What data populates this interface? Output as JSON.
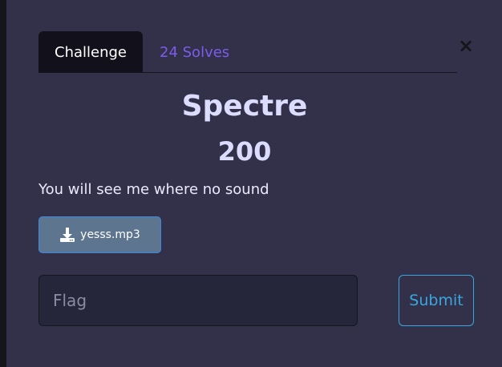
{
  "colors": {
    "background": "#333149",
    "tab_active_bg": "#12111b",
    "tab_inactive_text": "#7c5cec",
    "heading_text": "#dcdcff",
    "file_button_bg": "#5e7590",
    "file_button_border": "#3a86e0",
    "submit_accent": "#3aa6e0"
  },
  "dialog": {
    "close_icon": "close-icon",
    "close_glyph": "×"
  },
  "tabs": [
    {
      "label": "Challenge",
      "active": true
    },
    {
      "label": "24 Solves",
      "active": false
    }
  ],
  "challenge": {
    "name": "Spectre",
    "points": "200",
    "description": "You will see me where no sound"
  },
  "files": [
    {
      "name": "yesss.mp3",
      "icon": "download-icon"
    }
  ],
  "flag_form": {
    "placeholder": "Flag",
    "value": "",
    "submit_label": "Submit"
  }
}
